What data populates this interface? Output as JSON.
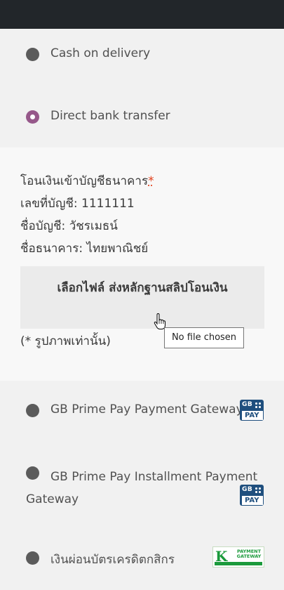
{
  "payment_methods": [
    {
      "label": "Cash on delivery",
      "selected": false
    },
    {
      "label": "Direct bank transfer",
      "selected": true
    },
    {
      "label": "GB Prime Pay Payment Gateway",
      "selected": false,
      "icon": "gb-prime-pay-icon"
    },
    {
      "label": "GB Prime Pay Installment Payment Gateway",
      "selected": false,
      "icon": "gb-prime-pay-icon"
    },
    {
      "label": "เงินผ่อนบัตรเครดิตกสิกร",
      "selected": false,
      "icon": "kbank-payment-gateway-icon"
    }
  ],
  "bank_transfer": {
    "title": "โอนเงินเข้าบัญชีธนาคาร",
    "required_mark": "*",
    "account_number": "เลขที่บัญชี: 1111111",
    "account_name": "ชื่อบัญชี: วัชรเมธน์",
    "bank_name": "ชื่อธนาคาร: ไทยพาณิชย์",
    "upload_button": "เลือกไฟล์ ส่งหลักฐานสลิปโอนเงิน",
    "tooltip": "No file chosen",
    "note": "(* รูปภาพเท่านั้น)"
  },
  "icons": {
    "gb_text": "GB",
    "pay_text": "PAY",
    "k_text": "K",
    "k_caption": "PAYMENT GATEWAY"
  },
  "colors": {
    "topbar": "#22262a",
    "radio_selected": "#96588a",
    "required": "#e2401c"
  }
}
